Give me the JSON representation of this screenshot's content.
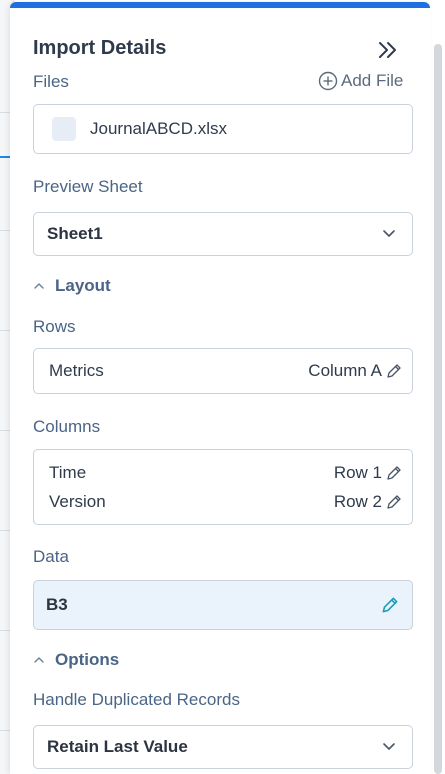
{
  "panel": {
    "title": "Import Details",
    "collapse_icon": "double-chevron-right-icon"
  },
  "files": {
    "label": "Files",
    "add_label": "Add File",
    "items": [
      {
        "name": "JournalABCD.xlsx"
      }
    ]
  },
  "preview_sheet": {
    "label": "Preview Sheet",
    "value": "Sheet1"
  },
  "layout": {
    "section_label": "Layout",
    "rows": {
      "label": "Rows",
      "items": [
        {
          "name": "Metrics",
          "mapping": "Column A"
        }
      ]
    },
    "columns": {
      "label": "Columns",
      "items": [
        {
          "name": "Time",
          "mapping": "Row 1"
        },
        {
          "name": "Version",
          "mapping": "Row 2"
        }
      ]
    },
    "data": {
      "label": "Data",
      "value": "B3"
    }
  },
  "options": {
    "section_label": "Options",
    "duplicates": {
      "label": "Handle Duplicated Records",
      "value": "Retain Last Value"
    }
  },
  "colors": {
    "accent": "#1e6fe0",
    "label": "#4a6585",
    "data_highlight": "#eaf3fb",
    "pencil_active": "#1a9bb3"
  }
}
